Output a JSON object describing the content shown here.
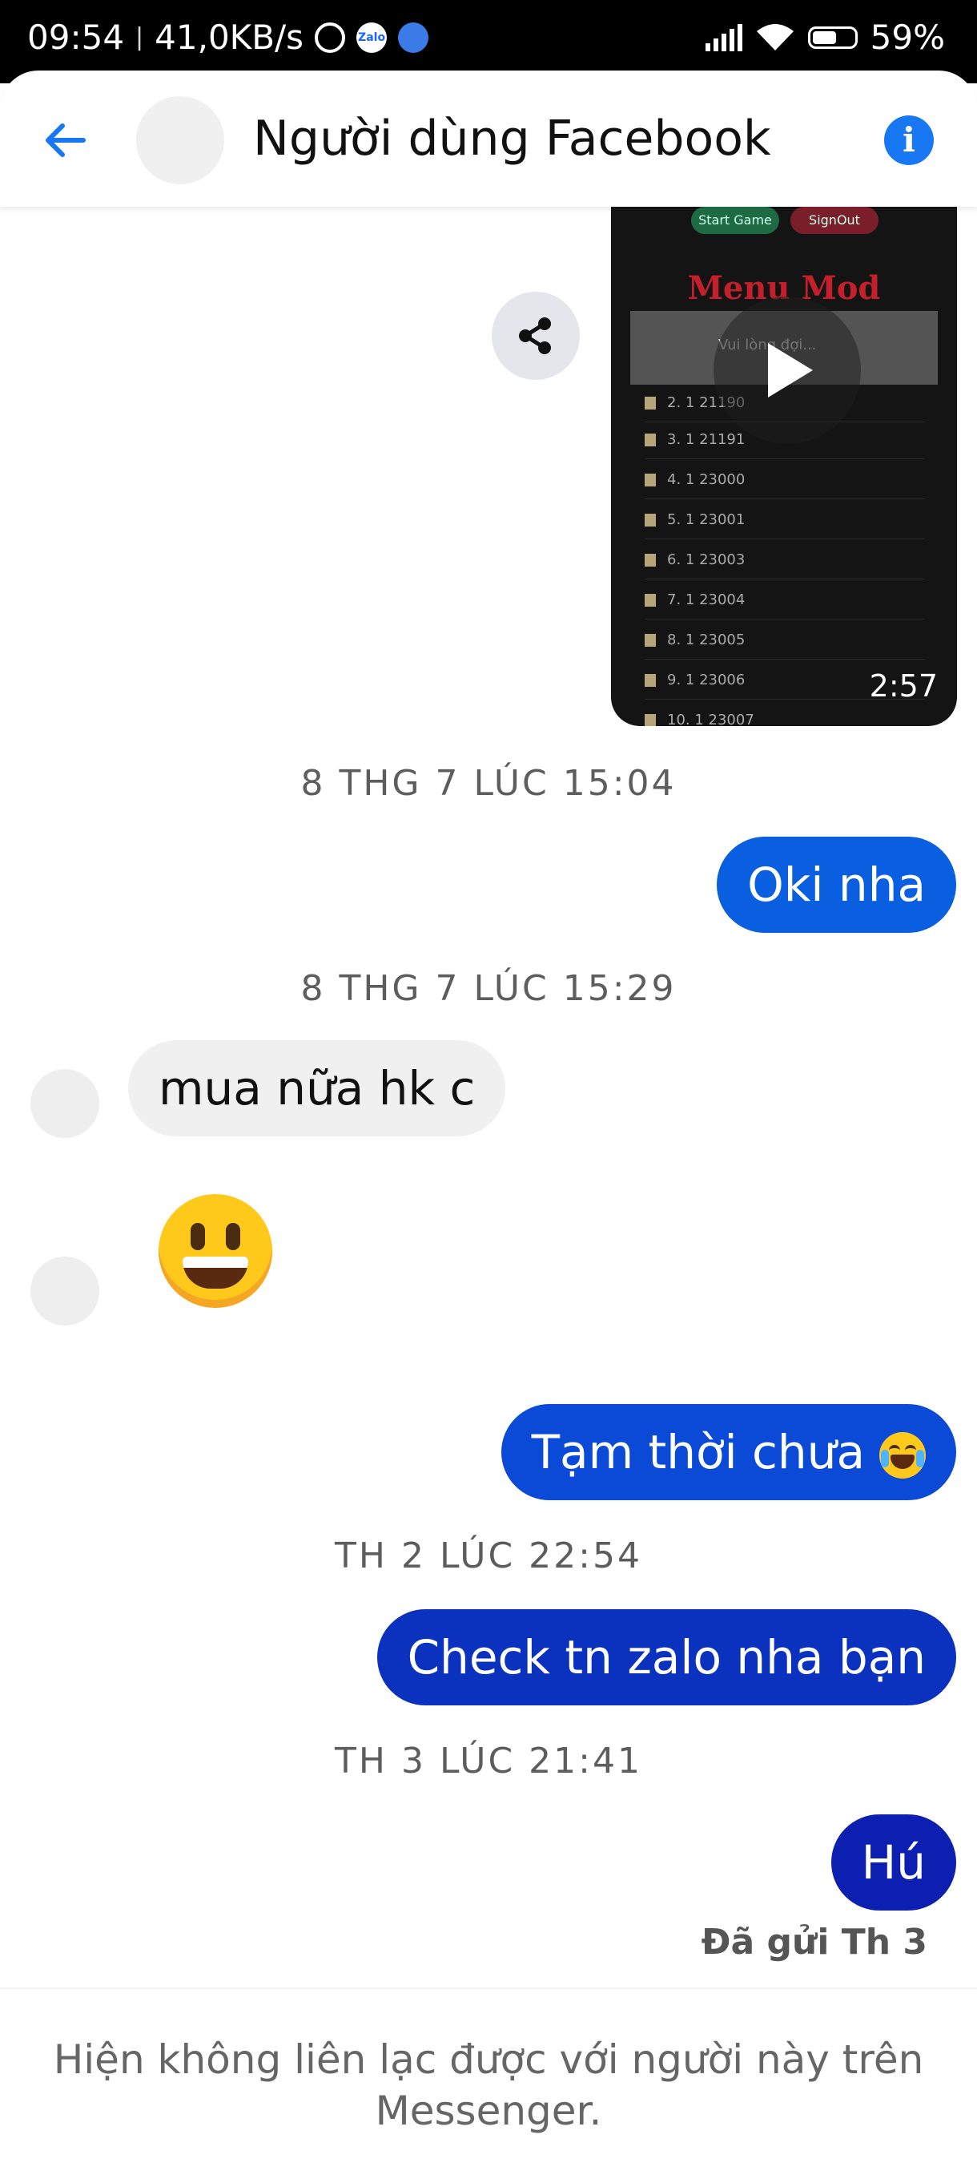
{
  "status_bar": {
    "time": "09:54",
    "net_speed": "41,0KB/s",
    "separator": "|",
    "zalo_label": "Zalo",
    "battery": "59%"
  },
  "header": {
    "title": "Người dùng Facebook",
    "info_label": "i"
  },
  "video": {
    "btn_start": "Start Game",
    "btn_signout": "SignOut",
    "menu_title": "Menu Mod",
    "bar_text": "Vui lòng đợi...",
    "rows": [
      "2. 1 21190",
      "3. 1 21191",
      "4. 1 23000",
      "5. 1 23001",
      "6. 1 23003",
      "7. 1 23004",
      "8. 1 23005",
      "9. 1 23006",
      "10. 1 23007"
    ],
    "duration": "2:57"
  },
  "messages": {
    "ts1": "8 THG 7 LÚC 15:04",
    "m1": "Oki nha",
    "ts2": "8 THG 7 LÚC 15:29",
    "m2": "mua nữa hk c",
    "m3": "Tạm thời chưa",
    "ts3": "TH 2 LÚC 22:54",
    "m4": "Check tn zalo nha bạn",
    "ts4": "TH 3 LÚC 21:41",
    "m5": "Hú",
    "sent_status": "Đã gửi Th 3"
  },
  "footer": {
    "notice": "Hiện không liên lạc được với người này trên Messenger."
  },
  "colors": {
    "accent": "#1877f2",
    "bubble_1": "#0a5ee0",
    "bubble_2": "#0b4ad6",
    "bubble_3": "#0b31bf",
    "bubble_4": "#0c1fb0",
    "incoming_bubble": "#f0f0f0"
  },
  "icons": {
    "back": "arrow-left-icon",
    "info": "info-icon",
    "share": "share-icon",
    "play": "play-icon"
  }
}
